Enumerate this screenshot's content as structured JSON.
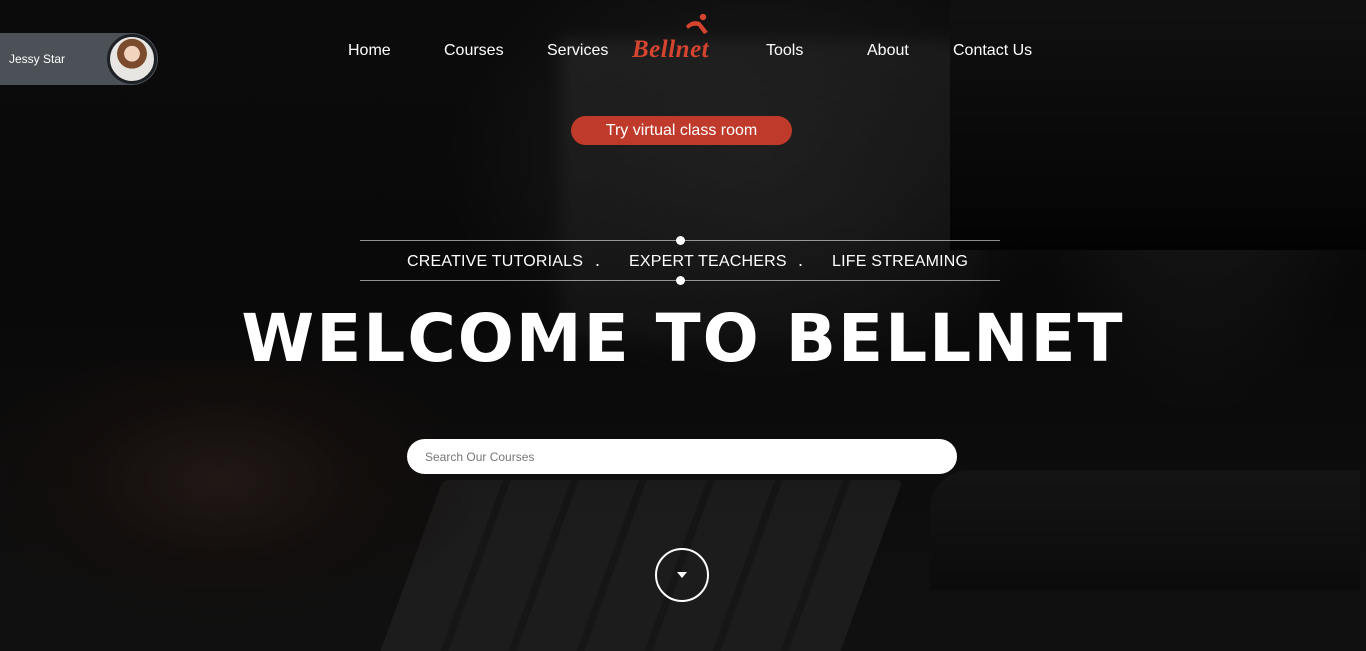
{
  "user": {
    "name": "Jessy Star"
  },
  "nav": {
    "items": [
      "Home",
      "Courses",
      "Services",
      "Tools",
      "About",
      "Contact Us"
    ],
    "logo": "Bellnet"
  },
  "cta": {
    "label": "Try virtual class room"
  },
  "tagline": {
    "items": [
      "CREATIVE TUTORIALS",
      "EXPERT TEACHERS",
      "LIFE STREAMING"
    ],
    "separator": "."
  },
  "hero": {
    "title": "WELCOME TO BELLNET"
  },
  "search": {
    "placeholder": "Search Our Courses",
    "value": ""
  },
  "icons": {
    "scroll": "chevron-down-icon",
    "logo_mark": "bell-icon"
  },
  "colors": {
    "accent": "#bf3a2b",
    "logo": "#d5442e",
    "chip": "#4b5157"
  }
}
